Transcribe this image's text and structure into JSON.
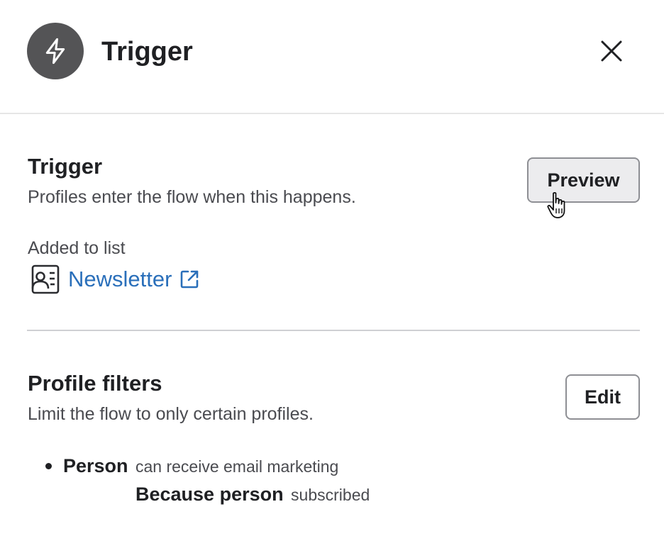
{
  "header": {
    "title": "Trigger",
    "badge_icon": "lightning-icon",
    "close_icon": "close-icon"
  },
  "trigger_section": {
    "title": "Trigger",
    "description": "Profiles enter the flow when this happens.",
    "preview_label": "Preview",
    "added_label": "Added to list",
    "list_name": "Newsletter",
    "list_icon": "contact-list-icon",
    "external_icon": "external-link-icon"
  },
  "filters_section": {
    "title": "Profile filters",
    "description": "Limit the flow to only certain profiles.",
    "edit_label": "Edit",
    "filter": {
      "subject": "Person",
      "condition": "can receive email marketing",
      "reason_subject": "Because person",
      "reason": "subscribed"
    }
  },
  "colors": {
    "badge": "#545456",
    "link": "#2a6fba",
    "preview_bg": "#ececee"
  }
}
